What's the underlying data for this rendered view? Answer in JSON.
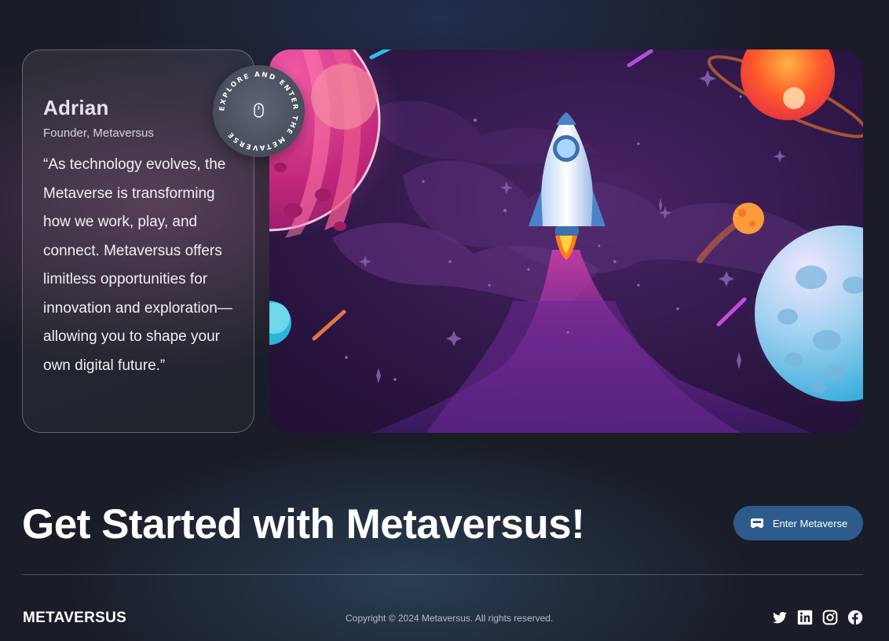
{
  "testimonial": {
    "name": "Adrian",
    "role": "Founder, Metaversus",
    "quote": "“As technology evolves, the Metaverse is transforming how we work, play, and connect. Metaversus offers limitless opportunities for innovation and exploration—allowing you to shape your own digital future.”"
  },
  "badge": {
    "text": "EXPLORE AND ENTER THE METAVERSE",
    "icon": "mouse-icon"
  },
  "hero": {
    "illustration": "rocket-launch-space-illustration"
  },
  "cta": {
    "headline": "Get Started with Metaversus!",
    "button_label": "Enter Metaverse",
    "button_icon": "vr-headset-icon",
    "button_color": "#2d5c8c"
  },
  "footer": {
    "logo": "METAVERSUS",
    "copyright": "Copyright © 2024 Metaversus. All rights reserved.",
    "social": [
      "twitter-icon",
      "linkedin-icon",
      "instagram-icon",
      "facebook-icon"
    ]
  }
}
